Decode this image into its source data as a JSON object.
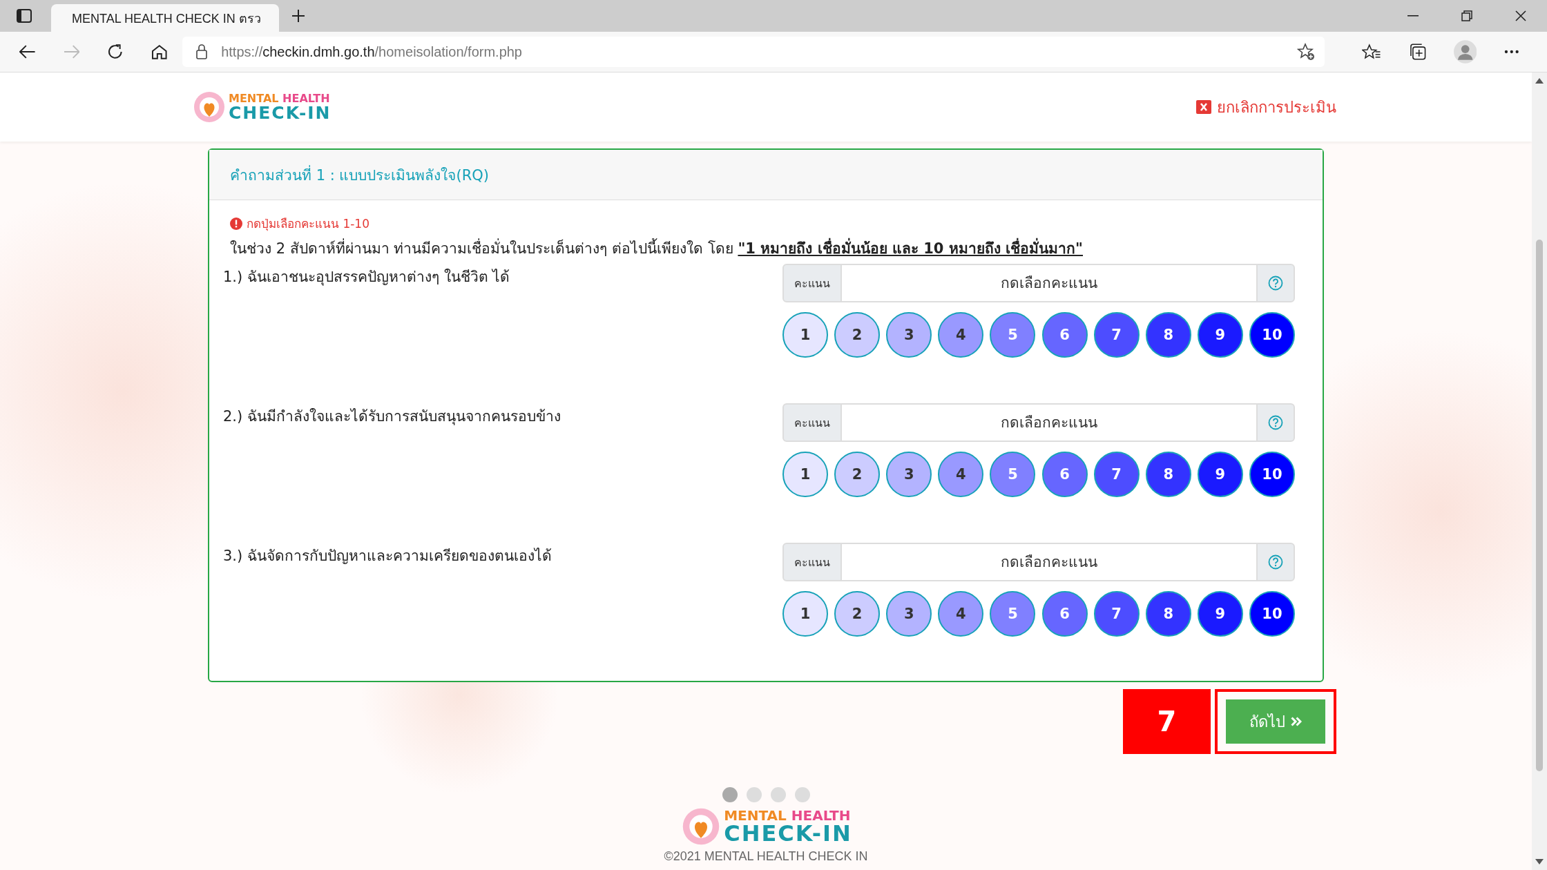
{
  "browser": {
    "tab": {
      "title": "MENTAL HEALTH CHECK IN ตรว",
      "selected": true
    },
    "address": {
      "scheme": "https://",
      "host": "checkin.dmh.go.th",
      "path": "/homeisolation/form.php"
    }
  },
  "header": {
    "logo": {
      "word_a": "MENTAL",
      "word_b": "HEALTH",
      "word_c": "CHECK-IN"
    },
    "cancel_link": "ยกเลิกการประเมิน"
  },
  "card": {
    "title": "คำถามส่วนที่ 1 : แบบประเมินพลังใจ(RQ)",
    "alert": "กดปุ่มเลือกคะแนน 1-10",
    "instruction": "ในช่วง 2 สัปดาห์ที่ผ่านมา ท่านมีความเชื่อมั่นในประเด็นต่างๆ ต่อไปนี้เพียงใด โดย **\"1 หมายถึง เชื่อมั่นน้อย และ 10 หมายถึง เชื่อมั่นมาก\"**",
    "questions": [
      {
        "label": "1.) ฉันเอาชนะอุปสรรคปัญหาต่างๆ ในชีวิต ได้",
        "addon": "คะแนน",
        "placeholder": "กดเลือกคะแนน",
        "options": [
          {
            "label": "1",
            "color": "#e6e6ff"
          },
          {
            "label": "2",
            "color": "#ccccff"
          },
          {
            "label": "3",
            "color": "#b3b3ff"
          },
          {
            "label": "4",
            "color": "#9999ff"
          },
          {
            "label": "5",
            "color": "#8080ff"
          },
          {
            "label": "6",
            "color": "#6666ff"
          },
          {
            "label": "7",
            "color": "#4d4dff"
          },
          {
            "label": "8",
            "color": "#3333ff"
          },
          {
            "label": "9",
            "color": "#1a1aff"
          },
          {
            "label": "10",
            "color": "#0000ff"
          }
        ]
      },
      {
        "label": "2.) ฉันมีกำลังใจและได้รับการสนับสนุนจากคนรอบข้าง",
        "addon": "คะแนน",
        "placeholder": "กดเลือกคะแนน",
        "options": [
          {
            "label": "1",
            "color": "#e6e6ff"
          },
          {
            "label": "2",
            "color": "#ccccff"
          },
          {
            "label": "3",
            "color": "#b3b3ff"
          },
          {
            "label": "4",
            "color": "#9999ff"
          },
          {
            "label": "5",
            "color": "#8080ff"
          },
          {
            "label": "6",
            "color": "#6666ff"
          },
          {
            "label": "7",
            "color": "#4d4dff"
          },
          {
            "label": "8",
            "color": "#3333ff"
          },
          {
            "label": "9",
            "color": "#1a1aff"
          },
          {
            "label": "10",
            "color": "#0000ff"
          }
        ]
      },
      {
        "label": "3.) ฉันจัดการกับปัญหาและความเครียดของตนเองได้",
        "addon": "คะแนน",
        "placeholder": "กดเลือกคะแนน",
        "options": [
          {
            "label": "1",
            "color": "#e6e6ff"
          },
          {
            "label": "2",
            "color": "#ccccff"
          },
          {
            "label": "3",
            "color": "#b3b3ff"
          },
          {
            "label": "4",
            "color": "#9999ff"
          },
          {
            "label": "5",
            "color": "#8080ff"
          },
          {
            "label": "6",
            "color": "#6666ff"
          },
          {
            "label": "7",
            "color": "#4d4dff"
          },
          {
            "label": "8",
            "color": "#3333ff"
          },
          {
            "label": "9",
            "color": "#1a1aff"
          },
          {
            "label": "10",
            "color": "#0000ff"
          }
        ]
      }
    ]
  },
  "step_badge": "7",
  "next_button": "ถัดไป",
  "carousel_dots": [
    {
      "selected": true
    },
    {
      "selected": false
    },
    {
      "selected": false
    },
    {
      "selected": false
    }
  ],
  "footer": {
    "logo": {
      "word_a": "MENTAL",
      "word_b": "HEALTH",
      "word_c": "CHECK-IN"
    },
    "copyright": "©2021  MENTAL HEALTH CHECK IN"
  }
}
